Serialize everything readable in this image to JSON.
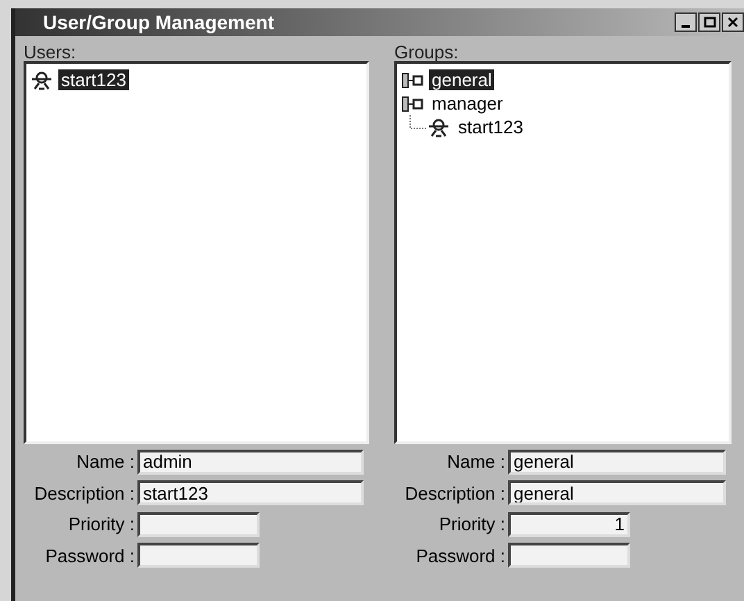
{
  "window": {
    "title": "User/Group Management"
  },
  "users": {
    "label": "Users:",
    "items": [
      {
        "name": "start123",
        "selected": true
      }
    ]
  },
  "groups": {
    "label": "Groups:",
    "items": [
      {
        "name": "general",
        "selected": true
      },
      {
        "name": "manager",
        "selected": false,
        "children": [
          {
            "name": "start123",
            "selected": false
          }
        ]
      }
    ]
  },
  "user_form": [
    {
      "label": "Name :",
      "value": "admin",
      "kind": "wide"
    },
    {
      "label": "Description :",
      "value": "start123",
      "kind": "wide"
    },
    {
      "label": "Priority :",
      "kind": "short"
    },
    {
      "label": "Password :",
      "kind": "short"
    }
  ],
  "group_form": [
    {
      "label": "Name :",
      "value": "general",
      "kind": "wide"
    },
    {
      "label": "Description :",
      "value": "general",
      "kind": "wide"
    },
    {
      "label": "Priority :",
      "value": "1",
      "kind": "number"
    },
    {
      "label": "Password :",
      "kind": "short"
    }
  ]
}
